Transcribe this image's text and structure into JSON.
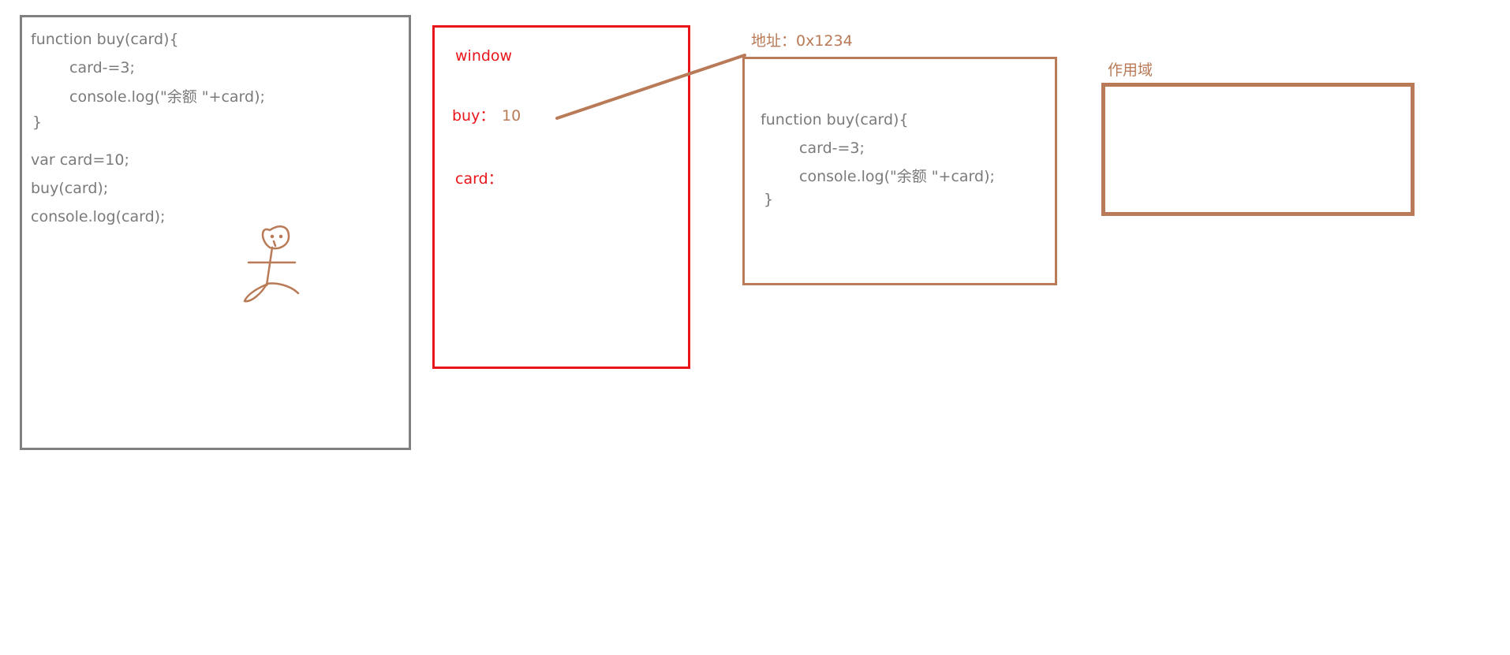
{
  "code_panel": {
    "lines": [
      "function buy(card){",
      "card-=3;",
      "console.log(\"余额 \"+card);",
      "}",
      "var card=10;",
      "buy(card);",
      "console.log(card);"
    ]
  },
  "window_panel": {
    "title": "window",
    "buy_label": "buy：",
    "buy_value": "10",
    "card_label": "card："
  },
  "function_panel": {
    "address_label": "地址：0x1234",
    "lines": [
      "function buy(card){",
      "card-=3;",
      "console.log(\"余额 \"+card);",
      "}"
    ]
  },
  "scope_panel": {
    "label": "作用域"
  },
  "colors": {
    "code_border": "#808080",
    "window_border": "#e8151b",
    "brown": "#b97a57",
    "code_text": "#7a7a7a"
  },
  "icons": {
    "figure": "stick-figure-icon"
  }
}
